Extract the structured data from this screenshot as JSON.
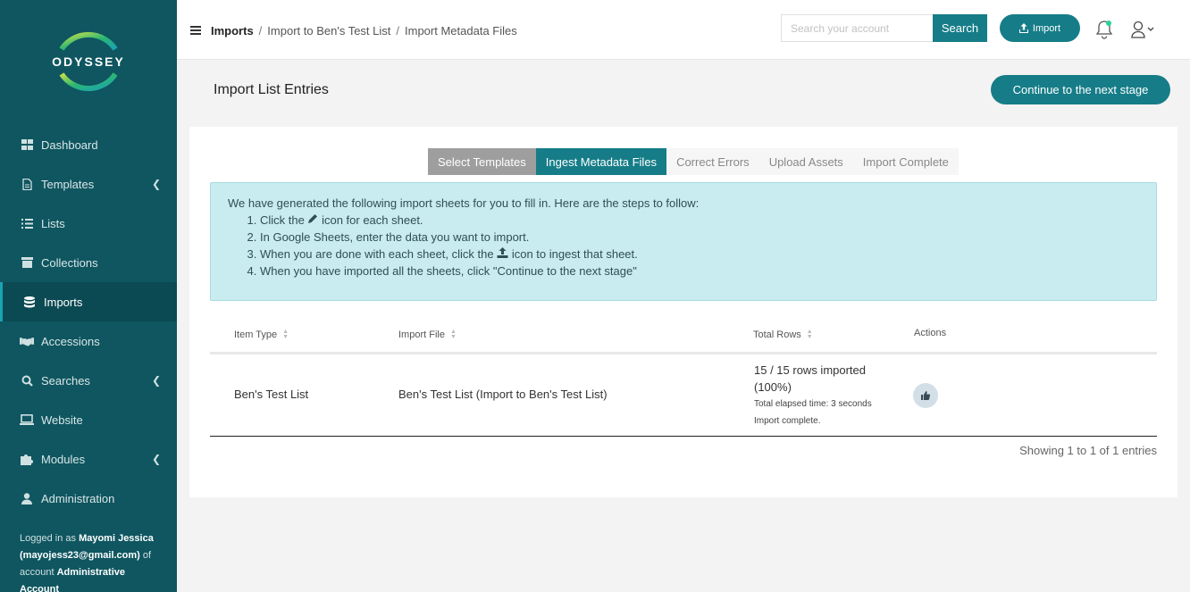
{
  "app": {
    "logo_text": "ODYSSEY"
  },
  "sidebar": {
    "items": [
      {
        "label": "Dashboard",
        "icon": "dashboard-icon",
        "chevron": false,
        "active": false
      },
      {
        "label": "Templates",
        "icon": "file-icon",
        "chevron": true,
        "active": false
      },
      {
        "label": "Lists",
        "icon": "list-icon",
        "chevron": false,
        "active": false
      },
      {
        "label": "Collections",
        "icon": "archive-icon",
        "chevron": false,
        "active": false
      },
      {
        "label": "Imports",
        "icon": "database-icon",
        "chevron": false,
        "active": true
      },
      {
        "label": "Accessions",
        "icon": "handshake-icon",
        "chevron": false,
        "active": false
      },
      {
        "label": "Searches",
        "icon": "search-icon",
        "chevron": true,
        "active": false
      },
      {
        "label": "Website",
        "icon": "laptop-icon",
        "chevron": false,
        "active": false
      },
      {
        "label": "Modules",
        "icon": "puzzle-icon",
        "chevron": true,
        "active": false
      },
      {
        "label": "Administration",
        "icon": "user-icon",
        "chevron": false,
        "active": false
      }
    ],
    "footer": {
      "prefix": "Logged in as ",
      "user_name": "Mayomi Jessica",
      "user_email": "(mayojess23@gmail.com)",
      "mid": " of account ",
      "account": "Administrative Account"
    }
  },
  "header": {
    "breadcrumb": [
      "Imports",
      "Import to Ben's Test List",
      "Import Metadata Files"
    ],
    "search_placeholder": "Search your account",
    "search_label": "Search",
    "import_label": "Import"
  },
  "page": {
    "title": "Import List Entries",
    "continue_label": "Continue to the next stage"
  },
  "steps": [
    {
      "label": "Select Templates",
      "state": "done"
    },
    {
      "label": "Ingest Metadata Files",
      "state": "current"
    },
    {
      "label": "Correct Errors",
      "state": "pending"
    },
    {
      "label": "Upload Assets",
      "state": "pending"
    },
    {
      "label": "Import Complete",
      "state": "pending"
    }
  ],
  "info": {
    "intro": "We have generated the following import sheets for you to fill in. Here are the steps to follow:",
    "step1_a": "Click the ",
    "step1_b": " icon for each sheet.",
    "step2": "In Google Sheets, enter the data you want to import.",
    "step3_a": "When you are done with each sheet, click the ",
    "step3_b": " icon to ingest that sheet.",
    "step4": "When you have imported all the sheets, click \"Continue to the next stage\""
  },
  "table": {
    "columns": [
      "Item Type",
      "Import File",
      "Total Rows",
      "Actions"
    ],
    "rows": [
      {
        "item_type": "Ben's Test List",
        "import_file": "Ben's Test List (Import to Ben's Test List)",
        "rows_imported": "15 / 15 rows imported",
        "percent": "(100%)",
        "elapsed": "Total elapsed time: 3 seconds",
        "status": "Import complete."
      }
    ],
    "showing": "Showing 1 to 1 of 1 entries"
  },
  "colors": {
    "sidebar": "#0f5660",
    "accent": "#167d88",
    "info_bg": "#c8ecf0"
  }
}
